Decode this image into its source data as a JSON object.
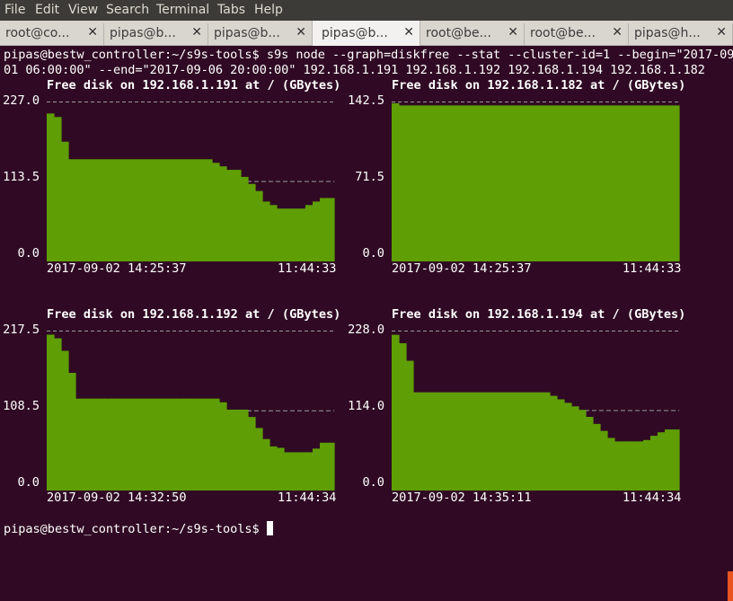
{
  "menubar": {
    "items": [
      "File",
      "Edit",
      "View",
      "Search",
      "Terminal",
      "Tabs",
      "Help"
    ]
  },
  "tabs": [
    {
      "label": "root@co..."
    },
    {
      "label": "pipas@b..."
    },
    {
      "label": "pipas@b..."
    },
    {
      "label": "pipas@b...",
      "active": true
    },
    {
      "label": "root@be..."
    },
    {
      "label": "root@be..."
    },
    {
      "label": "pipas@h..."
    }
  ],
  "terminal": {
    "command_line1": "pipas@bestw_controller:~/s9s-tools$ s9s node --graph=diskfree --stat --cluster-id=1 --begin=\"2017-09-",
    "command_line2": "01 06:00:00\" --end=\"2017-09-06 20:00:00\" 192.168.1.191 192.168.1.192 192.168.1.194 192.168.1.182",
    "prompt": "pipas@bestw_controller:~/s9s-tools$ "
  },
  "colors": {
    "bar": "#5f9e05",
    "background": "#300a24",
    "text": "#ffffff",
    "grid": "#9a9a9a"
  },
  "chart_data": [
    {
      "type": "area",
      "title": "Free disk on 192.168.1.191 at / (GBytes)",
      "yticks": [
        "227.0",
        "113.5",
        "0.0"
      ],
      "ylim": [
        0,
        227.0
      ],
      "x_start": "2017-09-02 14:25:37",
      "x_end": "11:44:33",
      "values": [
        210,
        205,
        170,
        145,
        145,
        145,
        145,
        145,
        145,
        145,
        145,
        145,
        145,
        145,
        145,
        145,
        145,
        145,
        145,
        145,
        145,
        145,
        145,
        140,
        135,
        130,
        130,
        120,
        110,
        100,
        85,
        80,
        75,
        75,
        75,
        75,
        80,
        85,
        90,
        90
      ],
      "avg_line": 113.5
    },
    {
      "type": "area",
      "title": "Free disk on 192.168.1.182 at / (GBytes)",
      "yticks": [
        "142.5",
        "71.5",
        "0.0"
      ],
      "ylim": [
        0,
        142.5
      ],
      "x_start": "2017-09-02 14:25:37",
      "x_end": "11:44:33",
      "values": [
        141,
        139,
        139,
        139,
        139,
        139,
        139,
        139,
        139,
        139,
        139,
        139,
        139,
        139,
        139,
        139,
        139,
        139,
        139,
        139,
        139,
        139,
        139,
        139,
        139,
        139,
        139,
        139,
        139,
        139,
        139,
        139,
        139,
        139,
        139,
        139,
        139,
        139,
        139,
        139
      ],
      "avg_line": null
    },
    {
      "type": "area",
      "title": "Free disk on 192.168.1.192 at / (GBytes)",
      "yticks": [
        "217.5",
        "108.5",
        "0.0"
      ],
      "ylim": [
        0,
        217.5
      ],
      "x_start": "2017-09-02 14:32:50",
      "x_end": "11:44:34",
      "values": [
        212,
        207,
        190,
        160,
        125,
        125,
        125,
        125,
        125,
        125,
        125,
        125,
        125,
        125,
        125,
        125,
        125,
        125,
        125,
        125,
        125,
        125,
        125,
        125,
        120,
        110,
        110,
        110,
        100,
        85,
        70,
        60,
        58,
        52,
        52,
        52,
        52,
        57,
        65,
        65
      ],
      "avg_line": 108.5
    },
    {
      "type": "area",
      "title": "Free disk on 192.168.1.194 at / (GBytes)",
      "yticks": [
        "228.0",
        "114.0",
        "0.0"
      ],
      "ylim": [
        0,
        228.0
      ],
      "x_start": "2017-09-02 14:35:11",
      "x_end": "11:44:34",
      "values": [
        222,
        210,
        185,
        140,
        140,
        140,
        140,
        140,
        140,
        140,
        140,
        140,
        140,
        140,
        140,
        140,
        140,
        140,
        140,
        140,
        140,
        140,
        135,
        130,
        125,
        120,
        115,
        105,
        95,
        85,
        75,
        70,
        70,
        70,
        70,
        72,
        78,
        83,
        87,
        87
      ],
      "avg_line": 114.0
    }
  ]
}
